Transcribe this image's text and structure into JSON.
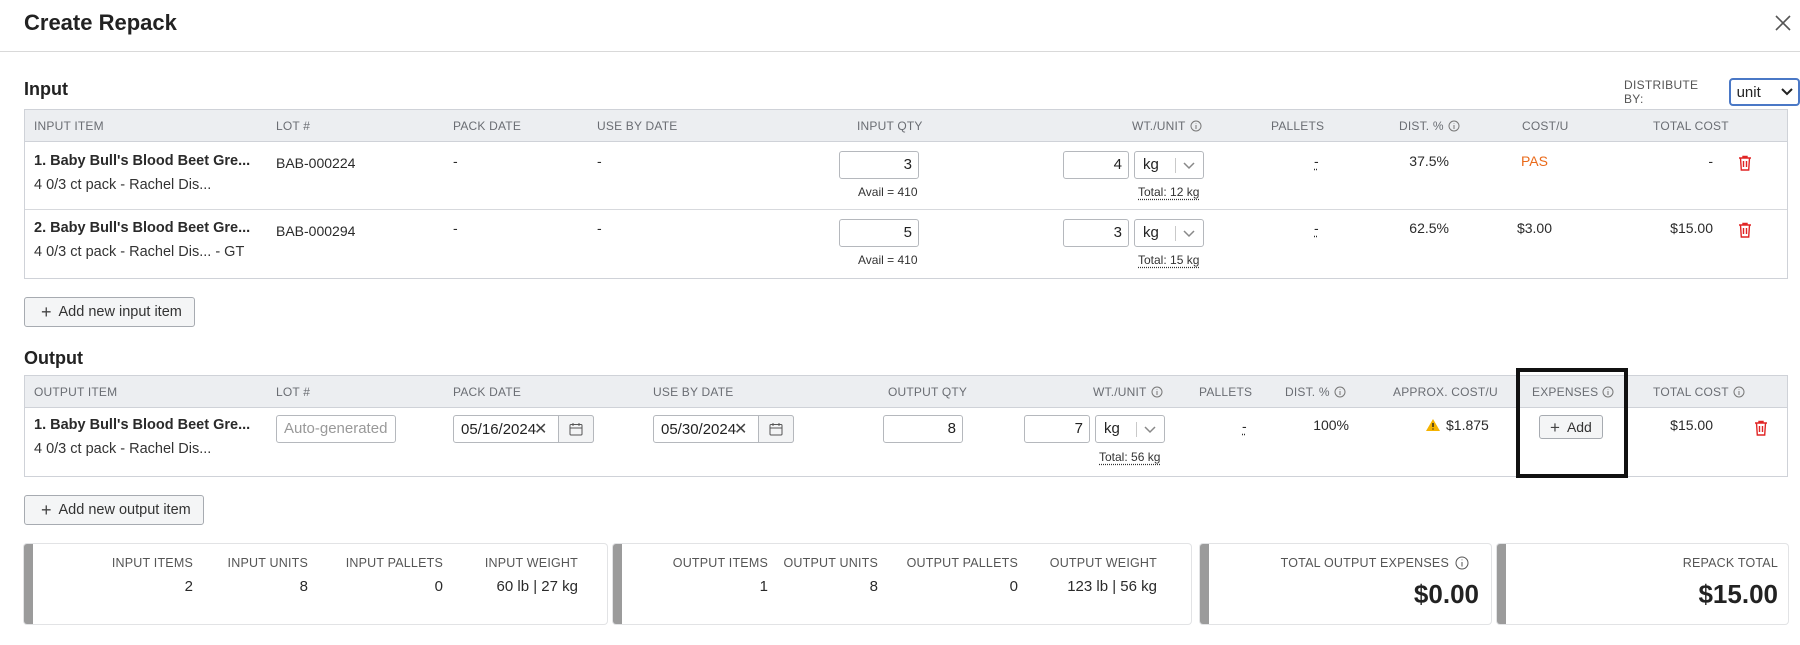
{
  "header": {
    "title": "Create Repack"
  },
  "input_section": {
    "title": "Input",
    "distribute_label": "DISTRIBUTE BY:",
    "distribute_value": "unit",
    "columns": [
      "INPUT ITEM",
      "LOT #",
      "PACK DATE",
      "USE BY DATE",
      "INPUT QTY",
      "WT./UNIT",
      "PALLETS",
      "DIST. %",
      "COST/U",
      "TOTAL COST"
    ],
    "rows": [
      {
        "name": "1. Baby Bull's Blood Beet Gre...",
        "sub": "4 0/3 ct pack - Rachel Dis...",
        "lot": "BAB-000224",
        "pack_date": "-",
        "use_by": "-",
        "qty": "3",
        "avail": "Avail = 410",
        "wt": "4",
        "unit": "kg",
        "total_wt": "Total: 12 kg",
        "pallets": "-",
        "dist": "37.5%",
        "cost_u": "PAS",
        "total_cost": "-"
      },
      {
        "name": "2. Baby Bull's Blood Beet Gre...",
        "sub": "4 0/3 ct pack - Rachel Dis... - GT",
        "lot": "BAB-000294",
        "pack_date": "-",
        "use_by": "-",
        "qty": "5",
        "avail": "Avail = 410",
        "wt": "3",
        "unit": "kg",
        "total_wt": "Total: 15 kg",
        "pallets": "-",
        "dist": "62.5%",
        "cost_u": "$3.00",
        "total_cost": "$15.00"
      }
    ],
    "add_label": "Add new input item"
  },
  "output_section": {
    "title": "Output",
    "columns": [
      "OUTPUT ITEM",
      "LOT #",
      "PACK DATE",
      "USE BY DATE",
      "OUTPUT QTY",
      "WT./UNIT",
      "PALLETS",
      "DIST. %",
      "APPROX. COST/U",
      "EXPENSES",
      "TOTAL COST"
    ],
    "rows": [
      {
        "name": "1. Baby Bull's Blood Beet Gre...",
        "sub": "4 0/3 ct pack - Rachel Dis...",
        "lot_placeholder": "Auto-generated",
        "pack_date": "05/16/2024",
        "use_by": "05/30/2024",
        "qty": "8",
        "wt": "7",
        "unit": "kg",
        "total_wt": "Total: 56 kg",
        "pallets": "-",
        "dist": "100%",
        "approx_cost": "$1.875",
        "expenses_btn": "Add",
        "total_cost": "$15.00"
      }
    ],
    "add_label": "Add new output item"
  },
  "summary": {
    "input": {
      "items_label": "INPUT ITEMS",
      "items": "2",
      "units_label": "INPUT UNITS",
      "units": "8",
      "pallets_label": "INPUT PALLETS",
      "pallets": "0",
      "weight_label": "INPUT WEIGHT",
      "weight": "60 lb | 27 kg"
    },
    "output": {
      "items_label": "OUTPUT ITEMS",
      "items": "1",
      "units_label": "OUTPUT UNITS",
      "units": "8",
      "pallets_label": "OUTPUT PALLETS",
      "pallets": "0",
      "weight_label": "OUTPUT WEIGHT",
      "weight": "123 lb | 56 kg"
    },
    "expenses": {
      "label": "TOTAL OUTPUT EXPENSES",
      "value": "$0.00"
    },
    "repack": {
      "label": "REPACK TOTAL",
      "value": "$15.00"
    }
  },
  "colors": {
    "accent": "#4a78c6",
    "danger": "#e02424",
    "warning": "#f5b301",
    "pas": "#ea6a1a"
  }
}
